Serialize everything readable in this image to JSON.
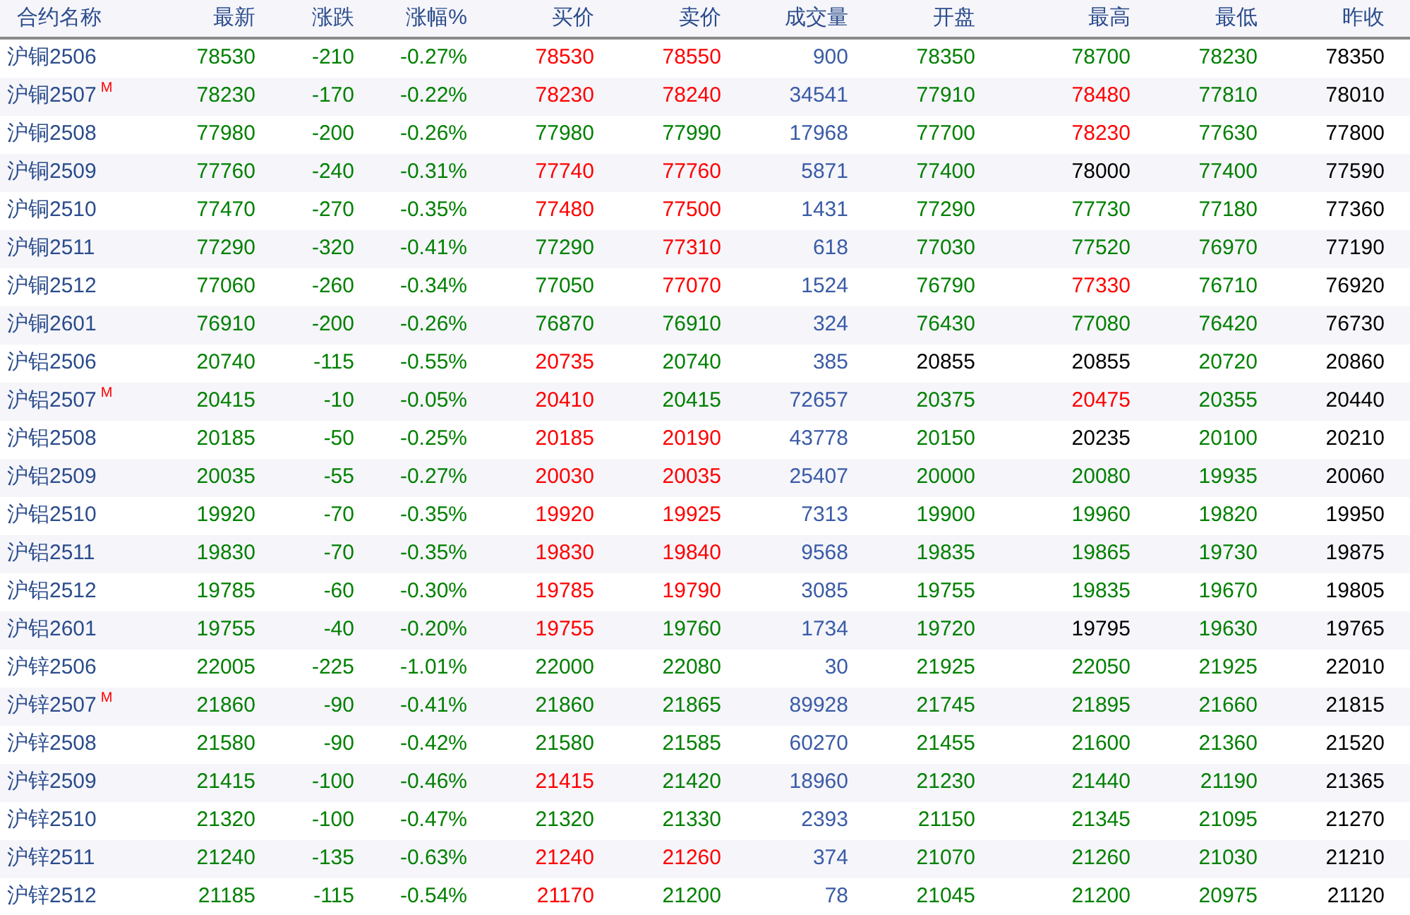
{
  "table": {
    "columns": [
      "合约名称",
      "最新",
      "涨跌",
      "涨幅%",
      "买价",
      "卖价",
      "成交量",
      "开盘",
      "最高",
      "最低",
      "昨收"
    ],
    "rows": [
      {
        "cells": [
          {
            "text": "沪铜2506"
          },
          {
            "text": "78530",
            "color": "#008000"
          },
          {
            "text": "-210",
            "color": "#008000"
          },
          {
            "text": "-0.27%",
            "color": "#008000"
          },
          {
            "text": "78530",
            "color": "#ff0000"
          },
          {
            "text": "78550",
            "color": "#ff0000"
          },
          {
            "text": "900"
          },
          {
            "text": "78350",
            "color": "#008000"
          },
          {
            "text": "78700",
            "color": "#008000"
          },
          {
            "text": "78230",
            "color": "#008000"
          },
          {
            "text": "78350"
          }
        ]
      },
      {
        "cells": [
          {
            "text": "沪铜2507",
            "tag": "M"
          },
          {
            "text": "78230",
            "color": "#008000"
          },
          {
            "text": "-170",
            "color": "#008000"
          },
          {
            "text": "-0.22%",
            "color": "#008000"
          },
          {
            "text": "78230",
            "color": "#ff0000"
          },
          {
            "text": "78240",
            "color": "#ff0000"
          },
          {
            "text": "34541"
          },
          {
            "text": "77910",
            "color": "#008000"
          },
          {
            "text": "78480",
            "color": "#ff0000"
          },
          {
            "text": "77810",
            "color": "#008000"
          },
          {
            "text": "78010"
          }
        ]
      },
      {
        "cells": [
          {
            "text": "沪铜2508"
          },
          {
            "text": "77980",
            "color": "#008000"
          },
          {
            "text": "-200",
            "color": "#008000"
          },
          {
            "text": "-0.26%",
            "color": "#008000"
          },
          {
            "text": "77980",
            "color": "#008000"
          },
          {
            "text": "77990",
            "color": "#008000"
          },
          {
            "text": "17968"
          },
          {
            "text": "77700",
            "color": "#008000"
          },
          {
            "text": "78230",
            "color": "#ff0000"
          },
          {
            "text": "77630",
            "color": "#008000"
          },
          {
            "text": "77800"
          }
        ]
      },
      {
        "cells": [
          {
            "text": "沪铜2509"
          },
          {
            "text": "77760",
            "color": "#008000"
          },
          {
            "text": "-240",
            "color": "#008000"
          },
          {
            "text": "-0.31%",
            "color": "#008000"
          },
          {
            "text": "77740",
            "color": "#ff0000"
          },
          {
            "text": "77760",
            "color": "#ff0000"
          },
          {
            "text": "5871"
          },
          {
            "text": "77400",
            "color": "#008000"
          },
          {
            "text": "78000",
            "color": "#000000"
          },
          {
            "text": "77400",
            "color": "#008000"
          },
          {
            "text": "77590"
          }
        ]
      },
      {
        "cells": [
          {
            "text": "沪铜2510"
          },
          {
            "text": "77470",
            "color": "#008000"
          },
          {
            "text": "-270",
            "color": "#008000"
          },
          {
            "text": "-0.35%",
            "color": "#008000"
          },
          {
            "text": "77480",
            "color": "#ff0000"
          },
          {
            "text": "77500",
            "color": "#ff0000"
          },
          {
            "text": "1431"
          },
          {
            "text": "77290",
            "color": "#008000"
          },
          {
            "text": "77730",
            "color": "#008000"
          },
          {
            "text": "77180",
            "color": "#008000"
          },
          {
            "text": "77360"
          }
        ]
      },
      {
        "cells": [
          {
            "text": "沪铜2511"
          },
          {
            "text": "77290",
            "color": "#008000"
          },
          {
            "text": "-320",
            "color": "#008000"
          },
          {
            "text": "-0.41%",
            "color": "#008000"
          },
          {
            "text": "77290",
            "color": "#008000"
          },
          {
            "text": "77310",
            "color": "#ff0000"
          },
          {
            "text": "618"
          },
          {
            "text": "77030",
            "color": "#008000"
          },
          {
            "text": "77520",
            "color": "#008000"
          },
          {
            "text": "76970",
            "color": "#008000"
          },
          {
            "text": "77190"
          }
        ]
      },
      {
        "cells": [
          {
            "text": "沪铜2512"
          },
          {
            "text": "77060",
            "color": "#008000"
          },
          {
            "text": "-260",
            "color": "#008000"
          },
          {
            "text": "-0.34%",
            "color": "#008000"
          },
          {
            "text": "77050",
            "color": "#008000"
          },
          {
            "text": "77070",
            "color": "#ff0000"
          },
          {
            "text": "1524"
          },
          {
            "text": "76790",
            "color": "#008000"
          },
          {
            "text": "77330",
            "color": "#ff0000"
          },
          {
            "text": "76710",
            "color": "#008000"
          },
          {
            "text": "76920"
          }
        ]
      },
      {
        "cells": [
          {
            "text": "沪铜2601"
          },
          {
            "text": "76910",
            "color": "#008000"
          },
          {
            "text": "-200",
            "color": "#008000"
          },
          {
            "text": "-0.26%",
            "color": "#008000"
          },
          {
            "text": "76870",
            "color": "#008000"
          },
          {
            "text": "76910",
            "color": "#008000"
          },
          {
            "text": "324"
          },
          {
            "text": "76430",
            "color": "#008000"
          },
          {
            "text": "77080",
            "color": "#008000"
          },
          {
            "text": "76420",
            "color": "#008000"
          },
          {
            "text": "76730"
          }
        ]
      },
      {
        "cells": [
          {
            "text": "沪铝2506"
          },
          {
            "text": "20740",
            "color": "#008000"
          },
          {
            "text": "-115",
            "color": "#008000"
          },
          {
            "text": "-0.55%",
            "color": "#008000"
          },
          {
            "text": "20735",
            "color": "#ff0000"
          },
          {
            "text": "20740",
            "color": "#008000"
          },
          {
            "text": "385"
          },
          {
            "text": "20855",
            "color": "#000000"
          },
          {
            "text": "20855",
            "color": "#000000"
          },
          {
            "text": "20720",
            "color": "#008000"
          },
          {
            "text": "20860"
          }
        ]
      },
      {
        "cells": [
          {
            "text": "沪铝2507",
            "tag": "M"
          },
          {
            "text": "20415",
            "color": "#008000"
          },
          {
            "text": "-10",
            "color": "#008000"
          },
          {
            "text": "-0.05%",
            "color": "#008000"
          },
          {
            "text": "20410",
            "color": "#ff0000"
          },
          {
            "text": "20415",
            "color": "#008000"
          },
          {
            "text": "72657"
          },
          {
            "text": "20375",
            "color": "#008000"
          },
          {
            "text": "20475",
            "color": "#ff0000"
          },
          {
            "text": "20355",
            "color": "#008000"
          },
          {
            "text": "20440"
          }
        ]
      },
      {
        "cells": [
          {
            "text": "沪铝2508"
          },
          {
            "text": "20185",
            "color": "#008000"
          },
          {
            "text": "-50",
            "color": "#008000"
          },
          {
            "text": "-0.25%",
            "color": "#008000"
          },
          {
            "text": "20185",
            "color": "#ff0000"
          },
          {
            "text": "20190",
            "color": "#ff0000"
          },
          {
            "text": "43778"
          },
          {
            "text": "20150",
            "color": "#008000"
          },
          {
            "text": "20235",
            "color": "#000000"
          },
          {
            "text": "20100",
            "color": "#008000"
          },
          {
            "text": "20210"
          }
        ]
      },
      {
        "cells": [
          {
            "text": "沪铝2509"
          },
          {
            "text": "20035",
            "color": "#008000"
          },
          {
            "text": "-55",
            "color": "#008000"
          },
          {
            "text": "-0.27%",
            "color": "#008000"
          },
          {
            "text": "20030",
            "color": "#ff0000"
          },
          {
            "text": "20035",
            "color": "#ff0000"
          },
          {
            "text": "25407"
          },
          {
            "text": "20000",
            "color": "#008000"
          },
          {
            "text": "20080",
            "color": "#008000"
          },
          {
            "text": "19935",
            "color": "#008000"
          },
          {
            "text": "20060"
          }
        ]
      },
      {
        "cells": [
          {
            "text": "沪铝2510"
          },
          {
            "text": "19920",
            "color": "#008000"
          },
          {
            "text": "-70",
            "color": "#008000"
          },
          {
            "text": "-0.35%",
            "color": "#008000"
          },
          {
            "text": "19920",
            "color": "#ff0000"
          },
          {
            "text": "19925",
            "color": "#ff0000"
          },
          {
            "text": "7313"
          },
          {
            "text": "19900",
            "color": "#008000"
          },
          {
            "text": "19960",
            "color": "#008000"
          },
          {
            "text": "19820",
            "color": "#008000"
          },
          {
            "text": "19950"
          }
        ]
      },
      {
        "cells": [
          {
            "text": "沪铝2511"
          },
          {
            "text": "19830",
            "color": "#008000"
          },
          {
            "text": "-70",
            "color": "#008000"
          },
          {
            "text": "-0.35%",
            "color": "#008000"
          },
          {
            "text": "19830",
            "color": "#ff0000"
          },
          {
            "text": "19840",
            "color": "#ff0000"
          },
          {
            "text": "9568"
          },
          {
            "text": "19835",
            "color": "#008000"
          },
          {
            "text": "19865",
            "color": "#008000"
          },
          {
            "text": "19730",
            "color": "#008000"
          },
          {
            "text": "19875"
          }
        ]
      },
      {
        "cells": [
          {
            "text": "沪铝2512"
          },
          {
            "text": "19785",
            "color": "#008000"
          },
          {
            "text": "-60",
            "color": "#008000"
          },
          {
            "text": "-0.30%",
            "color": "#008000"
          },
          {
            "text": "19785",
            "color": "#ff0000"
          },
          {
            "text": "19790",
            "color": "#ff0000"
          },
          {
            "text": "3085"
          },
          {
            "text": "19755",
            "color": "#008000"
          },
          {
            "text": "19835",
            "color": "#008000"
          },
          {
            "text": "19670",
            "color": "#008000"
          },
          {
            "text": "19805"
          }
        ]
      },
      {
        "cells": [
          {
            "text": "沪铝2601"
          },
          {
            "text": "19755",
            "color": "#008000"
          },
          {
            "text": "-40",
            "color": "#008000"
          },
          {
            "text": "-0.20%",
            "color": "#008000"
          },
          {
            "text": "19755",
            "color": "#ff0000"
          },
          {
            "text": "19760",
            "color": "#008000"
          },
          {
            "text": "1734"
          },
          {
            "text": "19720",
            "color": "#008000"
          },
          {
            "text": "19795",
            "color": "#000000"
          },
          {
            "text": "19630",
            "color": "#008000"
          },
          {
            "text": "19765"
          }
        ]
      },
      {
        "cells": [
          {
            "text": "沪锌2506"
          },
          {
            "text": "22005",
            "color": "#008000"
          },
          {
            "text": "-225",
            "color": "#008000"
          },
          {
            "text": "-1.01%",
            "color": "#008000"
          },
          {
            "text": "22000",
            "color": "#008000"
          },
          {
            "text": "22080",
            "color": "#008000"
          },
          {
            "text": "30"
          },
          {
            "text": "21925",
            "color": "#008000"
          },
          {
            "text": "22050",
            "color": "#008000"
          },
          {
            "text": "21925",
            "color": "#008000"
          },
          {
            "text": "22010"
          }
        ]
      },
      {
        "cells": [
          {
            "text": "沪锌2507",
            "tag": "M"
          },
          {
            "text": "21860",
            "color": "#008000"
          },
          {
            "text": "-90",
            "color": "#008000"
          },
          {
            "text": "-0.41%",
            "color": "#008000"
          },
          {
            "text": "21860",
            "color": "#008000"
          },
          {
            "text": "21865",
            "color": "#008000"
          },
          {
            "text": "89928"
          },
          {
            "text": "21745",
            "color": "#008000"
          },
          {
            "text": "21895",
            "color": "#008000"
          },
          {
            "text": "21660",
            "color": "#008000"
          },
          {
            "text": "21815"
          }
        ]
      },
      {
        "cells": [
          {
            "text": "沪锌2508"
          },
          {
            "text": "21580",
            "color": "#008000"
          },
          {
            "text": "-90",
            "color": "#008000"
          },
          {
            "text": "-0.42%",
            "color": "#008000"
          },
          {
            "text": "21580",
            "color": "#008000"
          },
          {
            "text": "21585",
            "color": "#008000"
          },
          {
            "text": "60270"
          },
          {
            "text": "21455",
            "color": "#008000"
          },
          {
            "text": "21600",
            "color": "#008000"
          },
          {
            "text": "21360",
            "color": "#008000"
          },
          {
            "text": "21520"
          }
        ]
      },
      {
        "cells": [
          {
            "text": "沪锌2509"
          },
          {
            "text": "21415",
            "color": "#008000"
          },
          {
            "text": "-100",
            "color": "#008000"
          },
          {
            "text": "-0.46%",
            "color": "#008000"
          },
          {
            "text": "21415",
            "color": "#ff0000"
          },
          {
            "text": "21420",
            "color": "#008000"
          },
          {
            "text": "18960"
          },
          {
            "text": "21230",
            "color": "#008000"
          },
          {
            "text": "21440",
            "color": "#008000"
          },
          {
            "text": "21190",
            "color": "#008000"
          },
          {
            "text": "21365"
          }
        ]
      },
      {
        "cells": [
          {
            "text": "沪锌2510"
          },
          {
            "text": "21320",
            "color": "#008000"
          },
          {
            "text": "-100",
            "color": "#008000"
          },
          {
            "text": "-0.47%",
            "color": "#008000"
          },
          {
            "text": "21320",
            "color": "#008000"
          },
          {
            "text": "21330",
            "color": "#008000"
          },
          {
            "text": "2393"
          },
          {
            "text": "21150",
            "color": "#008000"
          },
          {
            "text": "21345",
            "color": "#008000"
          },
          {
            "text": "21095",
            "color": "#008000"
          },
          {
            "text": "21270"
          }
        ]
      },
      {
        "cells": [
          {
            "text": "沪锌2511"
          },
          {
            "text": "21240",
            "color": "#008000"
          },
          {
            "text": "-135",
            "color": "#008000"
          },
          {
            "text": "-0.63%",
            "color": "#008000"
          },
          {
            "text": "21240",
            "color": "#ff0000"
          },
          {
            "text": "21260",
            "color": "#ff0000"
          },
          {
            "text": "374"
          },
          {
            "text": "21070",
            "color": "#008000"
          },
          {
            "text": "21260",
            "color": "#008000"
          },
          {
            "text": "21030",
            "color": "#008000"
          },
          {
            "text": "21210"
          }
        ]
      },
      {
        "cells": [
          {
            "text": "沪锌2512"
          },
          {
            "text": "21185",
            "color": "#008000"
          },
          {
            "text": "-115",
            "color": "#008000"
          },
          {
            "text": "-0.54%",
            "color": "#008000"
          },
          {
            "text": "21170",
            "color": "#ff0000"
          },
          {
            "text": "21200",
            "color": "#008000"
          },
          {
            "text": "78"
          },
          {
            "text": "21045",
            "color": "#008000"
          },
          {
            "text": "21200",
            "color": "#008000"
          },
          {
            "text": "20975",
            "color": "#008000"
          },
          {
            "text": "21120"
          }
        ]
      }
    ]
  }
}
